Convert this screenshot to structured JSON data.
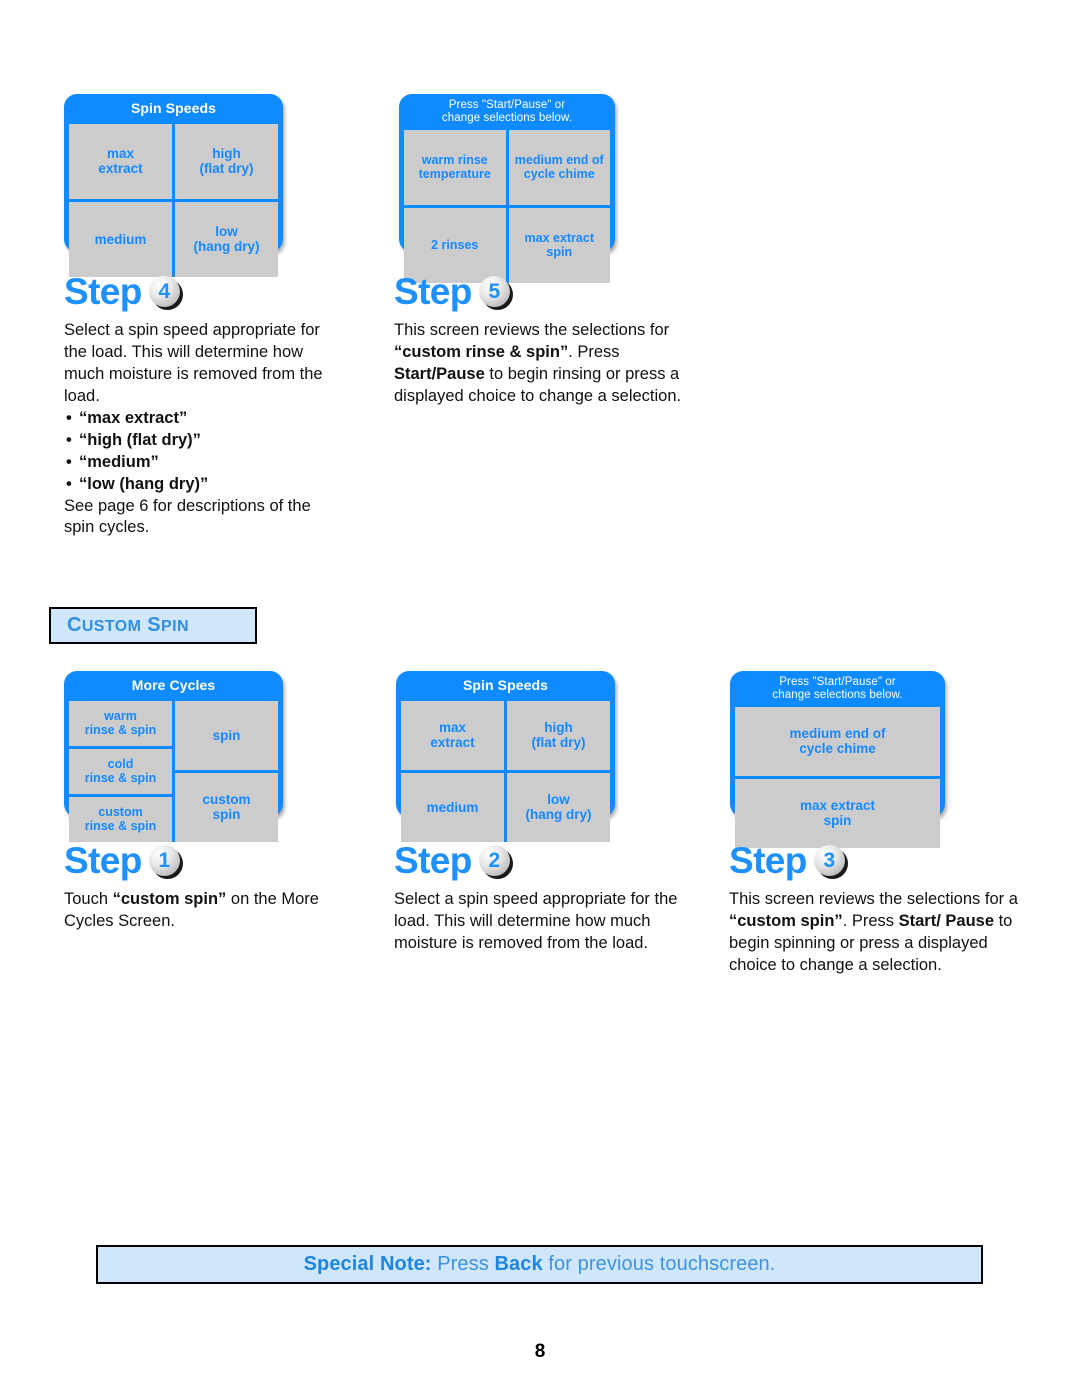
{
  "page": {
    "number": "8"
  },
  "screens": {
    "spin_speeds_top": {
      "title": "Spin Speeds",
      "cells": [
        [
          "max\nextract",
          "high\n(flat dry)"
        ],
        [
          "medium",
          "low\n(hang dry)"
        ]
      ]
    },
    "review_rinse_spin": {
      "title_line1": "Press \"Start/Pause\" or",
      "title_line2": "change selections below.",
      "cells": [
        [
          "warm rinse\ntemperature",
          "medium end of\ncycle chime"
        ],
        [
          "2 rinses",
          "max extract\nspin"
        ]
      ]
    },
    "more_cycles": {
      "title": "More Cycles",
      "left_column": [
        "warm\nrinse & spin",
        "cold\nrinse & spin",
        "custom\nrinse & spin"
      ],
      "right_column": [
        "spin",
        "custom\nspin"
      ]
    },
    "spin_speeds_bottom": {
      "title": "Spin Speeds",
      "cells": [
        [
          "max\nextract",
          "high\n(flat dry)"
        ],
        [
          "medium",
          "low\n(hang dry)"
        ]
      ]
    },
    "review_custom_spin": {
      "title_line1": "Press \"Start/Pause\" or",
      "title_line2": "change selections below.",
      "rows": [
        "medium end of\ncycle chime",
        "max extract\nspin"
      ]
    }
  },
  "steps": {
    "step4": {
      "word": "Step",
      "number": "4",
      "paragraph": "Select a spin speed appropriate for the load. This will determine how much moisture is removed from the load.",
      "bullets": [
        "“max extract”",
        "“high (flat dry)”",
        "“medium”",
        "“low (hang dry)”"
      ],
      "footnote": "See page 6 for descriptions of the spin cycles."
    },
    "step5": {
      "word": "Step",
      "number": "5",
      "text_part1": "This screen reviews the selections for ",
      "text_bold1": "“custom rinse & spin”",
      "text_part2": ". Press ",
      "text_bold2": "Start/Pause",
      "text_part3": " to begin rinsing or press a displayed choice to change a selection."
    },
    "step1": {
      "word": "Step",
      "number": "1",
      "text_part1": "Touch ",
      "text_bold1": "“custom spin”",
      "text_part2": " on the More Cycles Screen."
    },
    "step2": {
      "word": "Step",
      "number": "2",
      "paragraph": "Select a spin speed appropriate for the load. This will determine how much moisture is removed from the load."
    },
    "step3": {
      "word": "Step",
      "number": "3",
      "text_part1": "This screen reviews the selections for a ",
      "text_bold1": "“custom spin”",
      "text_part2": ". Press ",
      "text_bold2": "Start/ Pause",
      "text_part3": " to begin spinning or press a displayed choice to change a selection."
    }
  },
  "section_header": {
    "word_first_letter": "C",
    "word_rest": "USTOM",
    "word2_first_letter": "S",
    "word2_rest": "PIN",
    "full": "Custom Spin"
  },
  "special_note": {
    "label": "Special Note:",
    "text_part1": " Press ",
    "bold": "Back",
    "text_part2": " for previous touchscreen."
  },
  "colors": {
    "screen_blue": "#0f8bff",
    "cell_gray": "#cccccc",
    "cell_text_blue": "#1689ff",
    "step_blue": "#1f90ff",
    "note_bg": "#cfe6fb",
    "note_text": "#3e93e0"
  }
}
